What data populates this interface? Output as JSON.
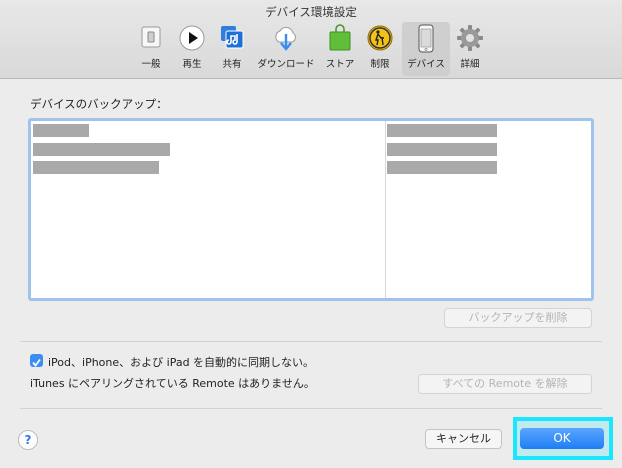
{
  "window": {
    "title": "デバイス環境設定"
  },
  "toolbar": {
    "items": [
      {
        "label": "一般",
        "icon": "general-switch-icon"
      },
      {
        "label": "再生",
        "icon": "play-icon"
      },
      {
        "label": "共有",
        "icon": "music-share-icon"
      },
      {
        "label": "ダウンロード",
        "icon": "cloud-download-icon"
      },
      {
        "label": "ストア",
        "icon": "shopping-bag-icon"
      },
      {
        "label": "制限",
        "icon": "parental-restriction-icon"
      },
      {
        "label": "デバイス",
        "icon": "iphone-icon",
        "selected": true
      },
      {
        "label": "詳細",
        "icon": "gear-icon"
      }
    ]
  },
  "backup": {
    "label": "デバイスのバックアップ：",
    "delete_button": "バックアップを削除"
  },
  "settings": {
    "prevent_sync_label": "iPod、iPhone、および iPad を自動的に同期しない。",
    "prevent_sync_checked": true,
    "remote_info": "iTunes にペアリングされている Remote はありません。",
    "unpair_button": "すべての Remote を解除"
  },
  "footer": {
    "help": "?",
    "cancel_button": "キャンセル",
    "ok_button": "OK"
  },
  "colors": {
    "accent": "#3b8cf3",
    "highlight": "#1ae6ff"
  }
}
